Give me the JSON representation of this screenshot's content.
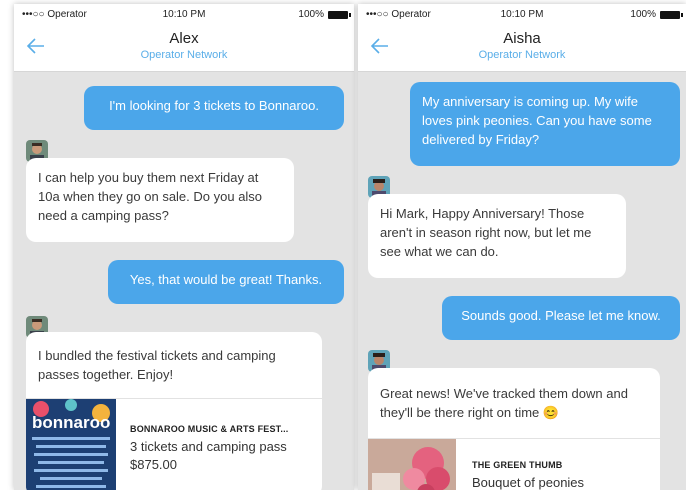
{
  "left_screen": {
    "status": {
      "carrier": "•••○○ Operator",
      "time": "10:10 PM",
      "battery": "100%"
    },
    "header": {
      "title": "Alex",
      "subtitle": "Operator Network"
    },
    "messages": [
      {
        "from": "user",
        "text": "I'm looking for 3 tickets to Bonnaroo."
      },
      {
        "from": "agent",
        "text": "I can help you buy them next Friday at 10a when they go on sale. Do you also need a camping pass?"
      },
      {
        "from": "user",
        "text": "Yes, that would be great! Thanks."
      },
      {
        "from": "agent",
        "text": "I bundled the festival tickets and camping passes together. Enjoy!"
      }
    ],
    "product": {
      "image_text": "bonnaroo",
      "name": "BONNAROO MUSIC & ARTS FEST...",
      "line1": "3 tickets and camping pass",
      "line2": "$875.00"
    }
  },
  "right_screen": {
    "status": {
      "carrier": "•••○○ Operator",
      "time": "10:10 PM",
      "battery": "100%"
    },
    "header": {
      "title": "Aisha",
      "subtitle": "Operator Network"
    },
    "messages": [
      {
        "from": "user",
        "text": "My anniversary is coming up. My wife loves pink peonies. Can you have some delivered by Friday?"
      },
      {
        "from": "agent",
        "text": "Hi Mark, Happy Anniversary! Those aren't in season right now, but let me see what we can do."
      },
      {
        "from": "user",
        "text": "Sounds good. Please let me know."
      },
      {
        "from": "agent",
        "text": "Great news! We've tracked them down and they'll be there right on time 😊"
      }
    ],
    "product": {
      "name": "THE GREEN THUMB",
      "line1": "Bouquet of peonies"
    }
  },
  "colors": {
    "accent": "#4ba6ea",
    "chat_background": "#e3e3e3",
    "agent_bubble": "#ffffff",
    "subtitle": "#5aaee8"
  }
}
